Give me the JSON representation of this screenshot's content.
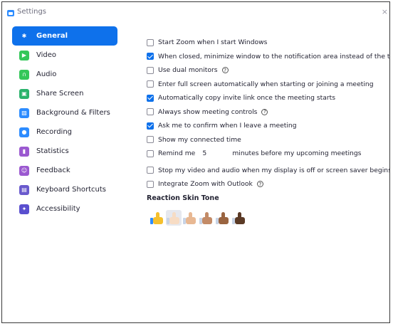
{
  "window": {
    "title": "Settings",
    "close_glyph": "×"
  },
  "sidebar": {
    "items": [
      {
        "label": "General",
        "icon": "gear-icon",
        "color": "#0e71eb",
        "active": true
      },
      {
        "label": "Video",
        "icon": "video-icon",
        "color": "#34c759",
        "active": false
      },
      {
        "label": "Audio",
        "icon": "headphones-icon",
        "color": "#34c759",
        "active": false
      },
      {
        "label": "Share Screen",
        "icon": "share-screen-icon",
        "color": "#2bb36c",
        "active": false
      },
      {
        "label": "Background & Filters",
        "icon": "background-icon",
        "color": "#2d8cff",
        "active": false
      },
      {
        "label": "Recording",
        "icon": "recording-icon",
        "color": "#2d8cff",
        "active": false
      },
      {
        "label": "Statistics",
        "icon": "statistics-icon",
        "color": "#9b59d0",
        "active": false
      },
      {
        "label": "Feedback",
        "icon": "feedback-icon",
        "color": "#9b59d0",
        "active": false
      },
      {
        "label": "Keyboard Shortcuts",
        "icon": "keyboard-icon",
        "color": "#6a5acd",
        "active": false
      },
      {
        "label": "Accessibility",
        "icon": "accessibility-icon",
        "color": "#5a4fcf",
        "active": false
      }
    ]
  },
  "general": {
    "options": [
      {
        "label": "Start Zoom when I start Windows",
        "checked": false
      },
      {
        "label": "When closed, minimize window to the notification area instead of the task bar",
        "checked": true
      },
      {
        "label": "Use dual monitors",
        "checked": false,
        "help": "?"
      },
      {
        "label": "Enter full screen automatically when starting or joining a meeting",
        "checked": false
      },
      {
        "label": "Automatically copy invite link once the meeting starts",
        "checked": true
      },
      {
        "label": "Always show meeting controls",
        "checked": false,
        "help": "?"
      },
      {
        "label": "Ask me to confirm when I leave a meeting",
        "checked": true
      },
      {
        "label": "Show my connected time",
        "checked": false
      }
    ],
    "remind": {
      "prefix": "Remind me",
      "value": "5",
      "suffix": "minutes before my upcoming meetings",
      "checked": false
    },
    "options2": [
      {
        "label": "Stop my video and audio when my display is off or screen saver begins",
        "checked": false
      },
      {
        "label": "Integrate Zoom with Outlook",
        "checked": false,
        "help": "?"
      }
    ],
    "reaction_title": "Reaction Skin Tone",
    "skin_tones": [
      {
        "name": "default-yellow",
        "color": "#f5c02e",
        "cuff": "#2d8cff"
      },
      {
        "name": "light",
        "color": "#f7dcc4",
        "cuff": "#c8d4e6",
        "selected": true
      },
      {
        "name": "medium-light",
        "color": "#e8b893",
        "cuff": "#c8d4e6"
      },
      {
        "name": "medium",
        "color": "#c38b67",
        "cuff": "#c8d4e6"
      },
      {
        "name": "medium-dark",
        "color": "#9a6440",
        "cuff": "#c8d4e6"
      },
      {
        "name": "dark",
        "color": "#5b3a26",
        "cuff": "#c8d4e6"
      }
    ]
  }
}
